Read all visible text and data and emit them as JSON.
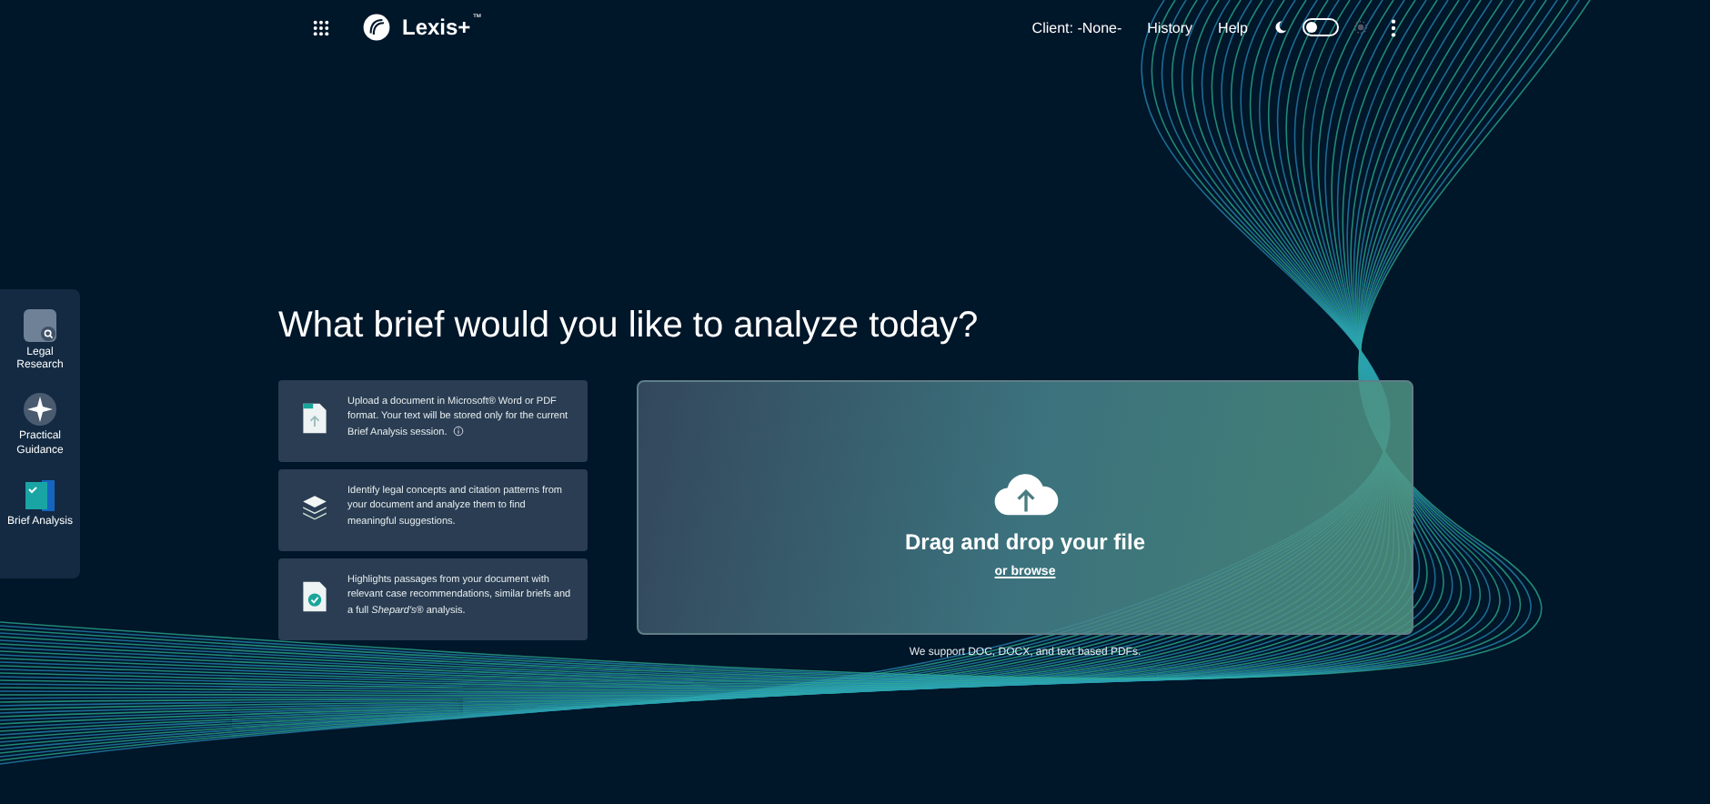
{
  "header": {
    "logo": "Lexis+",
    "logo_mark": "™",
    "nav": [
      "Client: -None-",
      "History",
      "Help"
    ],
    "dark_mode_toggle": {
      "on": false
    }
  },
  "sidebar": {
    "items": [
      {
        "kind": "research",
        "label": "Legal Research"
      },
      {
        "kind": "guidance",
        "label": "Practical Guidance"
      },
      {
        "kind": "brief",
        "label": "Brief Analysis"
      }
    ]
  },
  "heading": "What brief would you like to analyze today?",
  "info_cards": [
    {
      "kind": "upload",
      "text": "Upload a document in Microsoft® Word or PDF format. Your text will be stored only for the current Brief Analysis session."
    },
    {
      "kind": "layers",
      "text": "Identify legal concepts and citation patterns from your document and analyze them to find meaningful suggestions."
    },
    {
      "kind": "check",
      "text": "Highlights passages from your document with relevant case recommendations, similar briefs and a full *Shepard's*® analysis."
    }
  ],
  "dropzone": {
    "title": "Drag and drop your file",
    "link": "or browse",
    "note": "We support DOC, DOCX, and text based PDFs."
  }
}
